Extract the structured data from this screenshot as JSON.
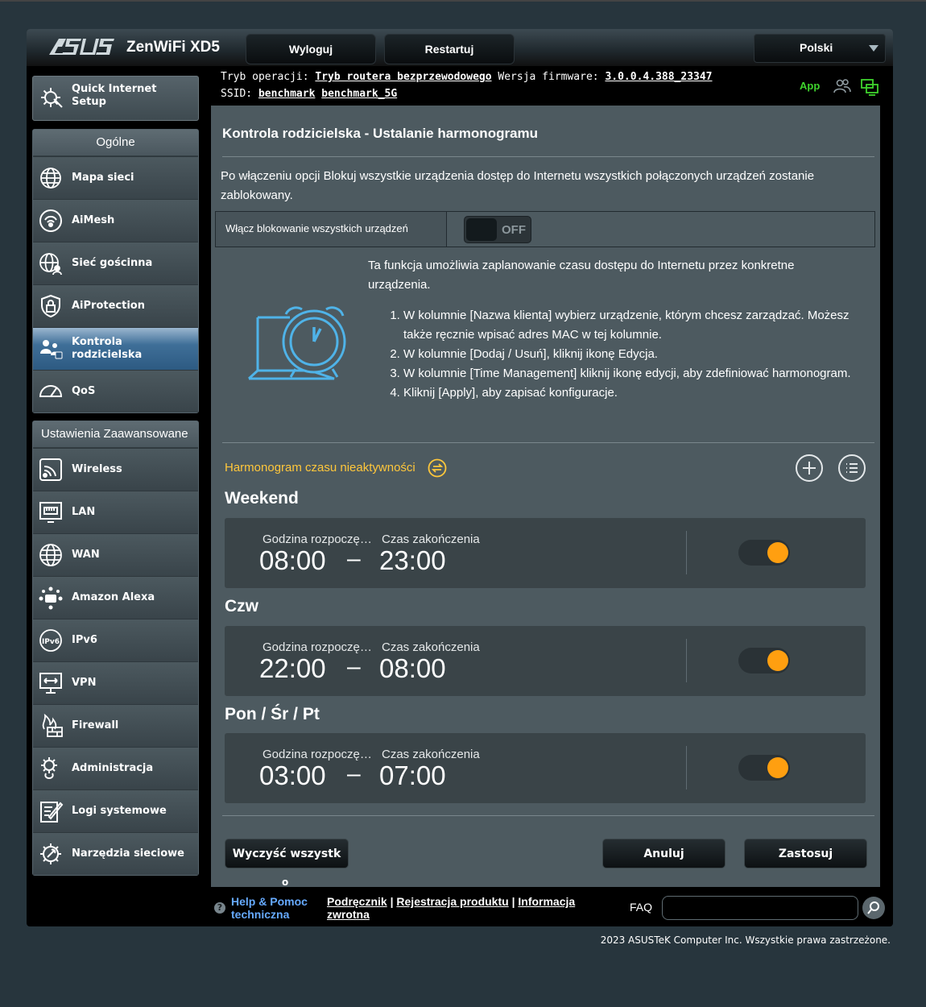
{
  "header": {
    "brand": "ASUS",
    "model": "ZenWiFi XD5",
    "logout": "Wyloguj",
    "reboot": "Restartuj",
    "language": "Polski"
  },
  "status": {
    "mode_label": "Tryb operacji:",
    "mode_value": "Tryb routera bezprzewodowego",
    "fw_label": "Wersja firmware:",
    "fw_value": "3.0.0.4.388_23347",
    "ssid_label": "SSID:",
    "ssid_1": "benchmark",
    "ssid_2": "benchmark_5G",
    "app": "App"
  },
  "sidebar": {
    "qis": "Quick Internet Setup",
    "general_title": "Ogólne",
    "general": [
      {
        "label": "Mapa sieci"
      },
      {
        "label": "AiMesh"
      },
      {
        "label": "Sieć gościnna"
      },
      {
        "label": "AiProtection"
      },
      {
        "label": "Kontrola rodzicielska",
        "active": true
      },
      {
        "label": "QoS"
      }
    ],
    "advanced_title": "Ustawienia Zaawansowane",
    "advanced": [
      {
        "label": "Wireless"
      },
      {
        "label": "LAN"
      },
      {
        "label": "WAN"
      },
      {
        "label": "Amazon Alexa"
      },
      {
        "label": "IPv6"
      },
      {
        "label": "VPN"
      },
      {
        "label": "Firewall"
      },
      {
        "label": "Administracja"
      },
      {
        "label": "Logi systemowe"
      },
      {
        "label": "Narzędzia sieciowe"
      }
    ]
  },
  "main": {
    "title": "Kontrola rodzicielska - Ustalanie harmonogramu",
    "description": "Po włączeniu opcji Blokuj wszystkie urządzenia dostęp do Internetu wszystkich połączonych urządzeń zostanie zablokowany.",
    "block_all_label": "Włącz blokowanie wszystkich urządzeń",
    "block_all_state": "OFF",
    "info": "Ta funkcja umożliwia zaplanowanie czasu dostępu do Internetu przez konkretne urządzenia.",
    "steps": [
      "W kolumnie [Nazwa klienta] wybierz urządzenie, którym chcesz zarządzać. Możesz także ręcznie wpisać adres MAC w tej kolumnie.",
      "W kolumnie [Dodaj / Usuń], kliknij ikonę Edycja.",
      "W kolumnie [Time Management] kliknij ikonę edycji, aby zdefiniować harmonogram.",
      "Kliknij [Apply], aby zapisać konfiguracje."
    ],
    "schedule_title": "Harmonogram czasu nieaktywności",
    "start_label": "Godzina rozpoczę…",
    "end_label": "Czas zakończenia",
    "schedules": [
      {
        "day": "Weekend",
        "start": "08:00",
        "end": "23:00",
        "enabled": true
      },
      {
        "day": "Czw",
        "start": "22:00",
        "end": "08:00",
        "enabled": true
      },
      {
        "day": "Pon / Śr / Pt",
        "start": "03:00",
        "end": "07:00",
        "enabled": true
      }
    ],
    "dash": "–",
    "clear_all": "Wyczyść wszystk",
    "clear_all_overflow": "o",
    "cancel": "Anuluj",
    "apply": "Zastosuj"
  },
  "footer": {
    "help_1": "Help & Pomoc",
    "help_2": "techniczna",
    "link_manual": "Podręcznik",
    "link_register": "Rejestracja produktu",
    "link_feedback": "Informacja zwrotna",
    "sep": "|",
    "faq": "FAQ",
    "copyright": "2023 ASUSTeK Computer Inc. Wszystkie prawa zastrzeżone."
  },
  "colors": {
    "accent_orange": "#ff9f10",
    "schedule_title": "#ffc73b",
    "app_green": "#3fd42d",
    "help_blue": "#66aaff"
  }
}
